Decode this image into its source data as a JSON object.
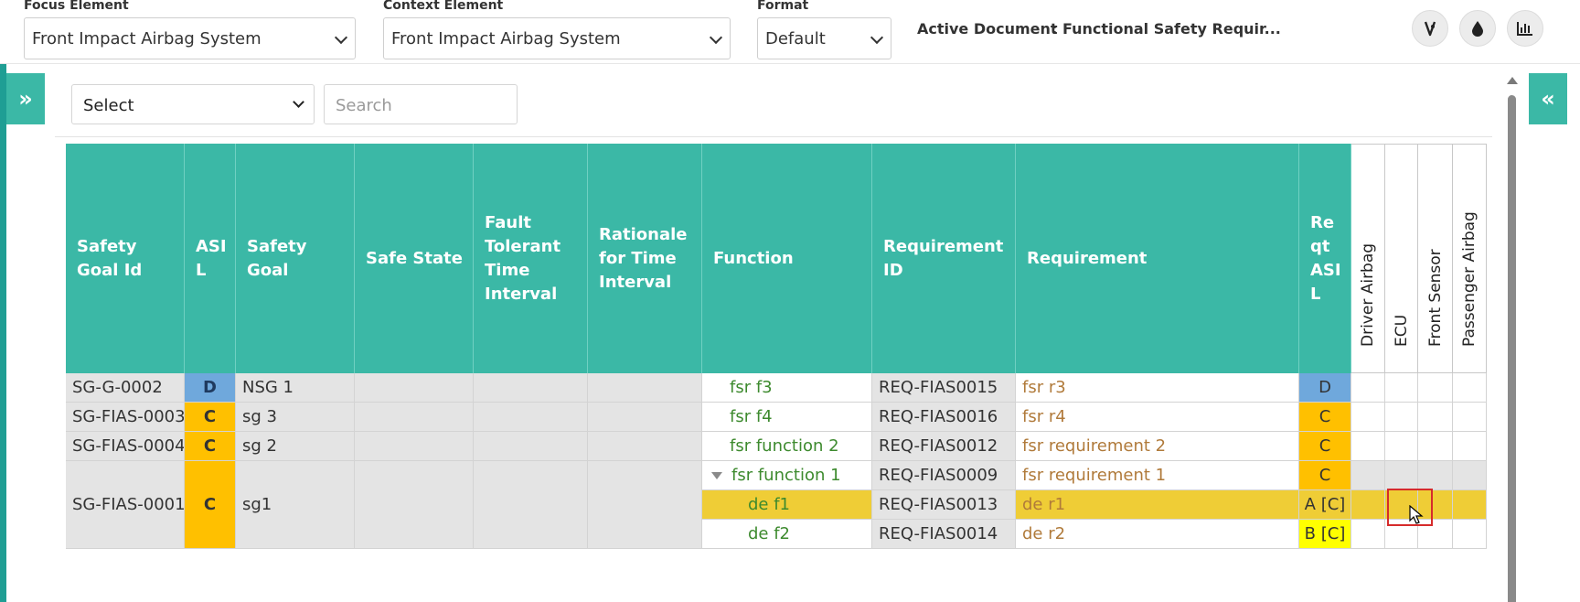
{
  "topbar": {
    "focus_label": "Focus Element",
    "focus_value": "Front Impact Airbag System",
    "context_label": "Context Element",
    "context_value": "Front Impact Airbag System",
    "format_label": "Format",
    "format_value": "Default",
    "active_doc_label": "Active Document",
    "active_doc_value": ": Functional Safety Requir...",
    "icons": [
      "network-icon",
      "drop-icon",
      "chart-icon"
    ]
  },
  "filters": {
    "select_label": "Select",
    "search_placeholder": "Search"
  },
  "table": {
    "headers": {
      "sg_id": "Safety Goal Id",
      "asil": "ASI L",
      "safety_goal": "Safety Goal",
      "safe_state": "Safe State",
      "ftti": "Fault Tolerant Time Interval",
      "rationale": "Rationale for Time Interval",
      "function": "Function",
      "req_id": "Requirement ID",
      "requirement": "Requirement",
      "req_asil": "Re qt ASI L",
      "driver_airbag": "Driver Airbag",
      "ecu": "ECU",
      "front_sensor": "Front Sensor",
      "passenger_airbag": "Passenger Airbag"
    },
    "goals": [
      {
        "id": "SG-G-0002",
        "asil": "D",
        "goal": "NSG 1"
      },
      {
        "id": "SG-FIAS-0003",
        "asil": "C",
        "goal": "sg 3"
      },
      {
        "id": "SG-FIAS-0004",
        "asil": "C",
        "goal": "sg 2"
      },
      {
        "id": "SG-FIAS-0001",
        "asil": "C",
        "goal": "sg1"
      }
    ],
    "rows": [
      {
        "function": "fsr f3",
        "req_id": "REQ-FIAS0015",
        "requirement": "fsr r3",
        "req_asil": "D"
      },
      {
        "function": "fsr f4",
        "req_id": "REQ-FIAS0016",
        "requirement": "fsr r4",
        "req_asil": "C"
      },
      {
        "function": "fsr function 2",
        "req_id": "REQ-FIAS0012",
        "requirement": "fsr requirement 2",
        "req_asil": "C"
      },
      {
        "function": "fsr function 1",
        "req_id": "REQ-FIAS0009",
        "requirement": "fsr requirement 1",
        "req_asil": "C"
      },
      {
        "function": "de f1",
        "req_id": "REQ-FIAS0013",
        "requirement": "de r1",
        "req_asil": "A [C]"
      },
      {
        "function": "de f2",
        "req_id": "REQ-FIAS0014",
        "requirement": "de r2",
        "req_asil": "B [C]"
      }
    ]
  },
  "colors": {
    "header_teal": "#3bb8a6",
    "asil_d": "#6fa8dc",
    "asil_c": "#ffc000",
    "selected_row": "#efcd36",
    "asil_b_yellow": "#ffff00"
  }
}
